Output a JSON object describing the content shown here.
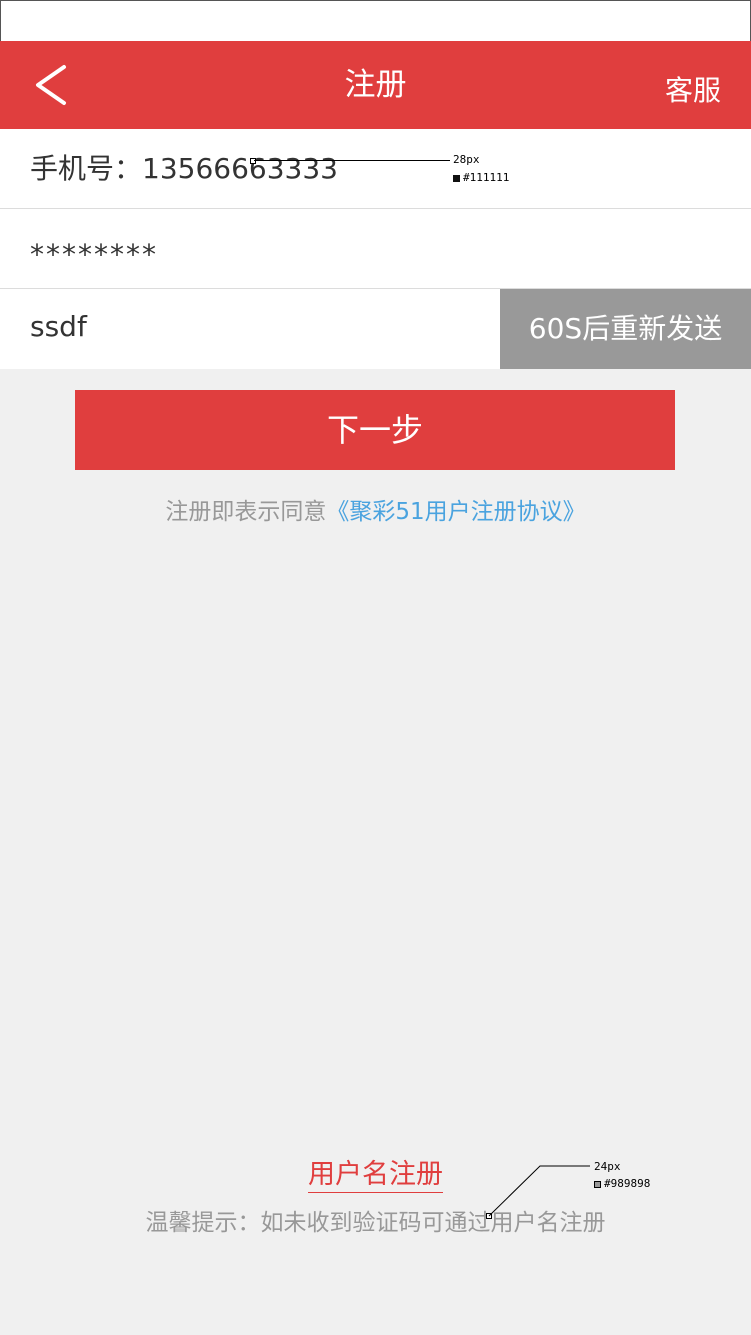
{
  "header": {
    "title": "注册",
    "service_label": "客服"
  },
  "form": {
    "phone_prefix": "手机号：",
    "phone_value": "13566663333",
    "password_value": "********",
    "code_value": "ssdf",
    "resend_label": "60S后重新发送"
  },
  "next_button": "下一步",
  "agreement": {
    "prefix": "注册即表示同意",
    "link": "《聚彩51用户注册协议》"
  },
  "username_register": "用户名注册",
  "tip": "温馨提示：如未收到验证码可通过用户名注册",
  "annotations": [
    {
      "size": "28px",
      "color_label": "#111111",
      "color": "#111111"
    },
    {
      "size": "24px",
      "color_label": "#989898",
      "color": "#989898"
    }
  ],
  "colors": {
    "primary_red": "#e03e3e",
    "link_blue": "#4aa3df",
    "gray_button": "#999999",
    "background": "#f0f0f0"
  }
}
